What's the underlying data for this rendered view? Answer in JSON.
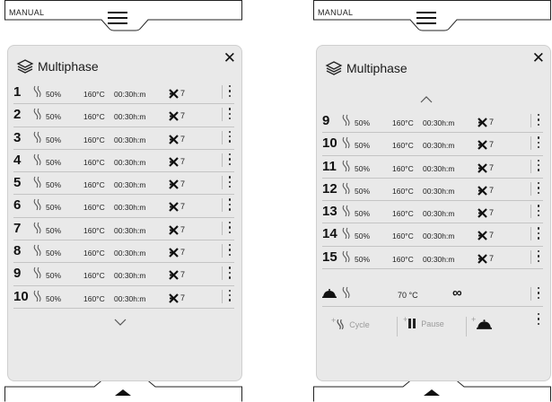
{
  "screens": [
    {
      "mode_label": "MANUAL",
      "title": "Multiphase",
      "phases": [
        {
          "num": "1",
          "fan_pct": "50%",
          "temp": "160°C",
          "time": "00:30h:m",
          "steam": "7"
        },
        {
          "num": "2",
          "fan_pct": "50%",
          "temp": "160°C",
          "time": "00:30h:m",
          "steam": "7"
        },
        {
          "num": "3",
          "fan_pct": "50%",
          "temp": "160°C",
          "time": "00:30h:m",
          "steam": "7"
        },
        {
          "num": "4",
          "fan_pct": "50%",
          "temp": "160°C",
          "time": "00:30h:m",
          "steam": "7"
        },
        {
          "num": "5",
          "fan_pct": "50%",
          "temp": "160°C",
          "time": "00:30h:m",
          "steam": "7"
        },
        {
          "num": "6",
          "fan_pct": "50%",
          "temp": "160°C",
          "time": "00:30h:m",
          "steam": "7"
        },
        {
          "num": "7",
          "fan_pct": "50%",
          "temp": "160°C",
          "time": "00:30h:m",
          "steam": "7"
        },
        {
          "num": "8",
          "fan_pct": "50%",
          "temp": "160°C",
          "time": "00:30h:m",
          "steam": "7"
        },
        {
          "num": "9",
          "fan_pct": "50%",
          "temp": "160°C",
          "time": "00:30h:m",
          "steam": "7"
        },
        {
          "num": "10",
          "fan_pct": "50%",
          "temp": "160°C",
          "time": "00:30h:m",
          "steam": "7"
        }
      ]
    },
    {
      "mode_label": "MANUAL",
      "title": "Multiphase",
      "phases": [
        {
          "num": "9",
          "fan_pct": "50%",
          "temp": "160°C",
          "time": "00:30h:m",
          "steam": "7"
        },
        {
          "num": "10",
          "fan_pct": "50%",
          "temp": "160°C",
          "time": "00:30h:m",
          "steam": "7"
        },
        {
          "num": "11",
          "fan_pct": "50%",
          "temp": "160°C",
          "time": "00:30h:m",
          "steam": "7"
        },
        {
          "num": "12",
          "fan_pct": "50%",
          "temp": "160°C",
          "time": "00:30h:m",
          "steam": "7"
        },
        {
          "num": "13",
          "fan_pct": "50%",
          "temp": "160°C",
          "time": "00:30h:m",
          "steam": "7"
        },
        {
          "num": "14",
          "fan_pct": "50%",
          "temp": "160°C",
          "time": "00:30h:m",
          "steam": "7"
        },
        {
          "num": "15",
          "fan_pct": "50%",
          "temp": "160°C",
          "time": "00:30h:m",
          "steam": "7"
        }
      ],
      "final_phase": {
        "temp": "70 °C",
        "duration": "∞"
      },
      "add_actions": {
        "cycle": "Cycle",
        "pause": "Pause"
      }
    }
  ]
}
